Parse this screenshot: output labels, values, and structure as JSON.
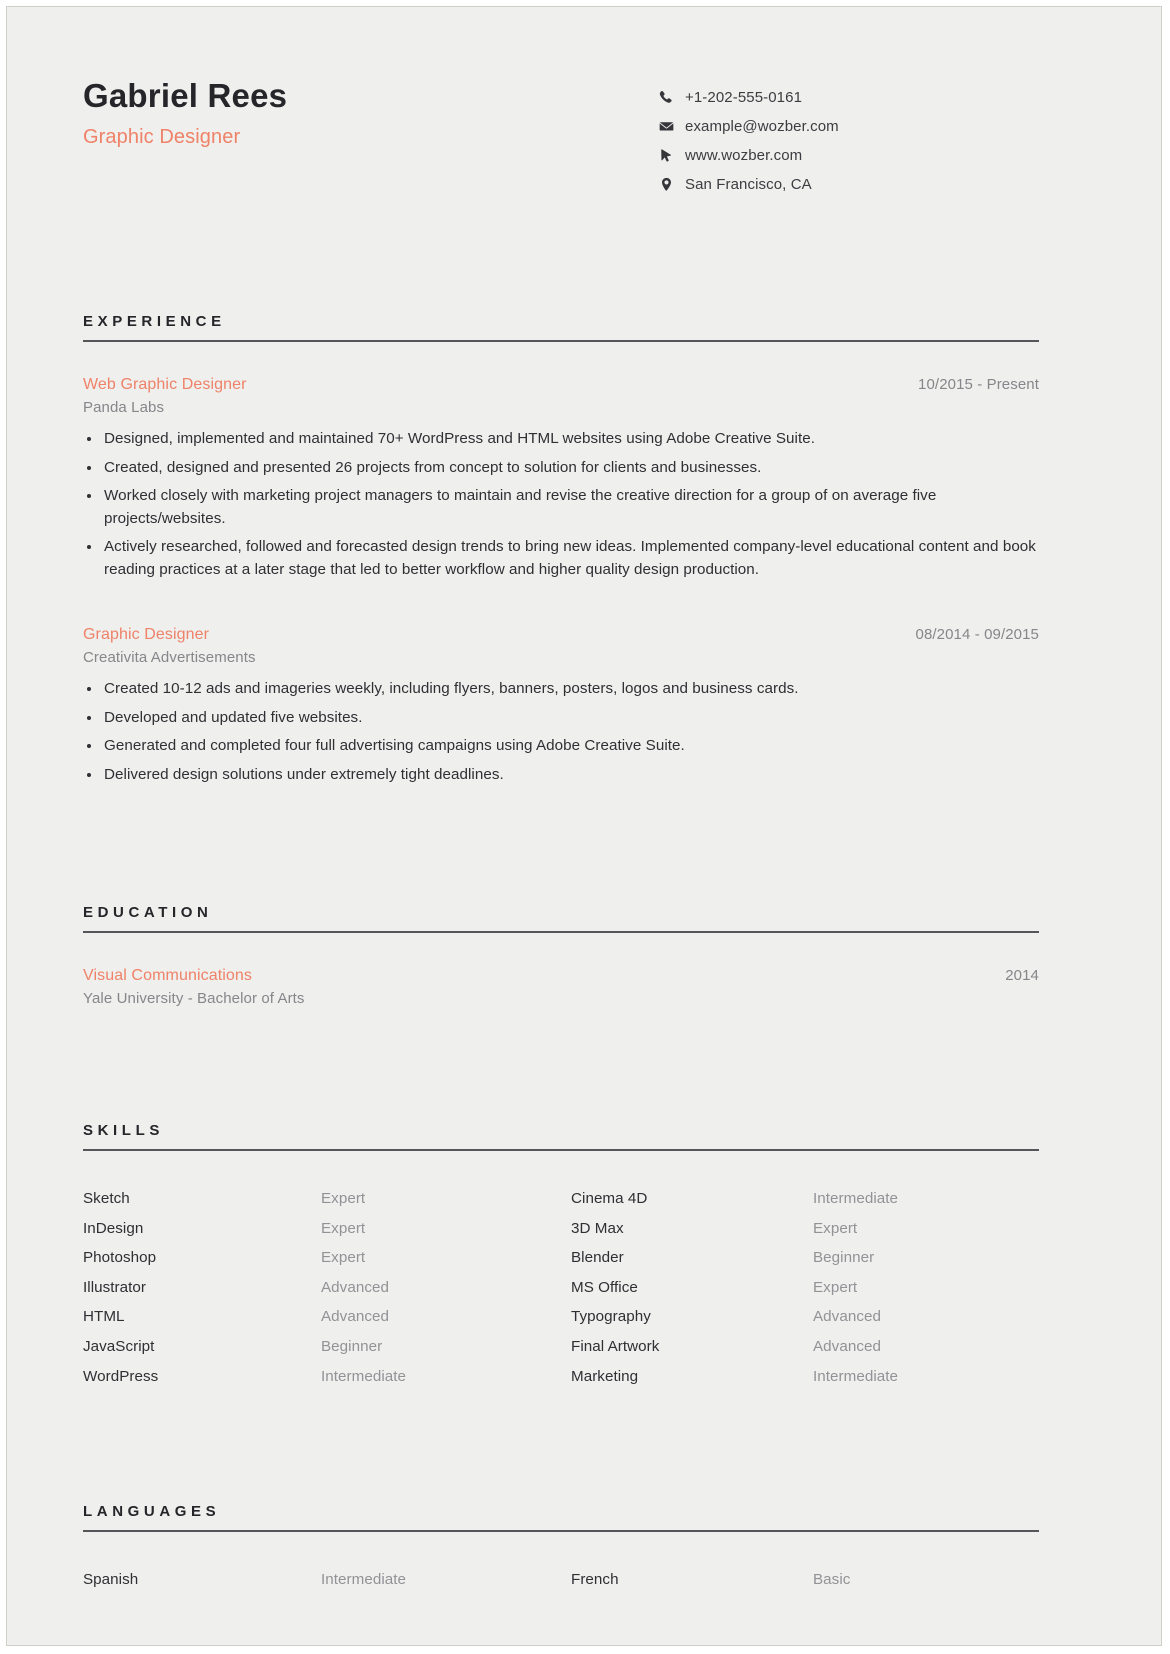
{
  "theme": {
    "page_background": "#efefed",
    "accent": "#ef8268",
    "text": "#2f2f34",
    "muted": "#86868b",
    "rule": "#55555a"
  },
  "header": {
    "name": "Gabriel Rees",
    "job_title": "Graphic Designer",
    "contacts": [
      {
        "icon": "phone-icon",
        "value": "+1-202-555-0161"
      },
      {
        "icon": "envelope-icon",
        "value": "example@wozber.com"
      },
      {
        "icon": "cursor-icon",
        "value": "www.wozber.com"
      },
      {
        "icon": "location-pin-icon",
        "value": "San Francisco, CA"
      }
    ]
  },
  "sections": {
    "experience": {
      "heading": "EXPERIENCE",
      "entries": [
        {
          "role": "Web Graphic Designer",
          "organization": "Panda Labs",
          "date": "10/2015 - Present",
          "bullets": [
            "Designed, implemented and maintained 70+ WordPress and HTML websites using Adobe Creative Suite.",
            "Created, designed and presented 26 projects from concept to solution for clients and businesses.",
            "Worked closely with marketing project managers to maintain and revise the creative direction for a group of on average five projects/websites.",
            "Actively researched, followed and forecasted design trends to bring new ideas. Implemented company-level educational content and book reading practices at a later stage that led to better workflow and higher quality design production."
          ]
        },
        {
          "role": "Graphic Designer",
          "organization": "Creativita Advertisements",
          "date": "08/2014 - 09/2015",
          "bullets": [
            "Created 10-12 ads and imageries weekly, including flyers, banners, posters, logos and business cards.",
            "Developed and updated five websites.",
            "Generated and completed four full advertising campaigns using Adobe Creative Suite.",
            "Delivered design solutions under extremely tight deadlines."
          ]
        }
      ]
    },
    "education": {
      "heading": "EDUCATION",
      "entries": [
        {
          "degree": "Visual Communications",
          "school": "Yale University - Bachelor of Arts",
          "date": "2014"
        }
      ]
    },
    "skills": {
      "heading": "SKILLS",
      "items": [
        {
          "name": "Sketch",
          "level": "Expert",
          "name2": "Cinema 4D",
          "level2": "Intermediate"
        },
        {
          "name": "InDesign",
          "level": "Expert",
          "name2": "3D Max",
          "level2": "Expert"
        },
        {
          "name": "Photoshop",
          "level": "Expert",
          "name2": "Blender",
          "level2": "Beginner"
        },
        {
          "name": "Illustrator",
          "level": "Advanced",
          "name2": "MS Office",
          "level2": "Expert"
        },
        {
          "name": "HTML",
          "level": "Advanced",
          "name2": "Typography",
          "level2": "Advanced"
        },
        {
          "name": "JavaScript",
          "level": "Beginner",
          "name2": "Final Artwork",
          "level2": "Advanced"
        },
        {
          "name": "WordPress",
          "level": "Intermediate",
          "name2": "Marketing",
          "level2": "Intermediate"
        }
      ]
    },
    "languages": {
      "heading": "LANGUAGES",
      "items": [
        {
          "name": "Spanish",
          "level": "Intermediate",
          "name2": "French",
          "level2": "Basic"
        }
      ]
    }
  }
}
